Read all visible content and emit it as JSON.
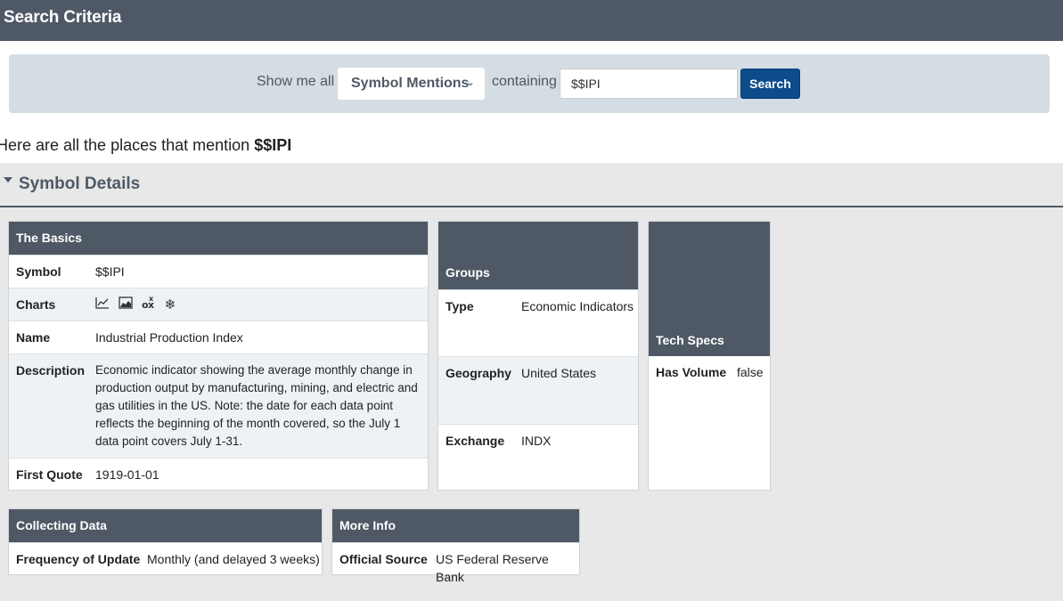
{
  "header": {
    "title": "Search Criteria"
  },
  "search": {
    "show_label": "Show me all",
    "type_value": "Symbol Mentions",
    "containing_label": "containing",
    "query": "$$IPI",
    "button_label": "Search"
  },
  "mentions": {
    "prefix": "Here are all the places that mention",
    "symbol": "$$IPI"
  },
  "symbol_details": {
    "title": "Symbol Details",
    "basics": {
      "title": "The Basics",
      "symbol_key": "Symbol",
      "symbol_val": "$$IPI",
      "charts_key": "Charts",
      "chart_icons": [
        "line-chart-icon",
        "area-chart-icon",
        "ox-chart-icon",
        "snowflake-icon"
      ],
      "name_key": "Name",
      "name_val": "Industrial Production Index",
      "desc_key": "Description",
      "desc_val": "Economic indicator showing the average monthly change in production output by manufacturing, mining, and electric and gas utilities in the US. Note: the date for each data point reflects the beginning of the month covered, so the July 1 data point covers July 1-31.",
      "first_quote_key": "First Quote",
      "first_quote_val": "1919-01-01"
    },
    "groups": {
      "title": "Groups",
      "type_key": "Type",
      "type_val": "Economic Indicators",
      "geo_key": "Geography",
      "geo_val": "United States",
      "exchange_key": "Exchange",
      "exchange_val": "INDX"
    },
    "tech": {
      "title": "Tech Specs",
      "volume_key": "Has Volume",
      "volume_val": "false"
    },
    "collecting": {
      "title": "Collecting Data",
      "freq_key": "Frequency of Update",
      "freq_val": "Monthly (and delayed 3 weeks)"
    },
    "more_info": {
      "title": "More Info",
      "source_key": "Official Source",
      "source_val": "US Federal Reserve Bank"
    }
  },
  "colors": {
    "header_bg": "#4f5965",
    "button_bg": "#0d4c8b",
    "panel_bg": "#d4dde4"
  }
}
